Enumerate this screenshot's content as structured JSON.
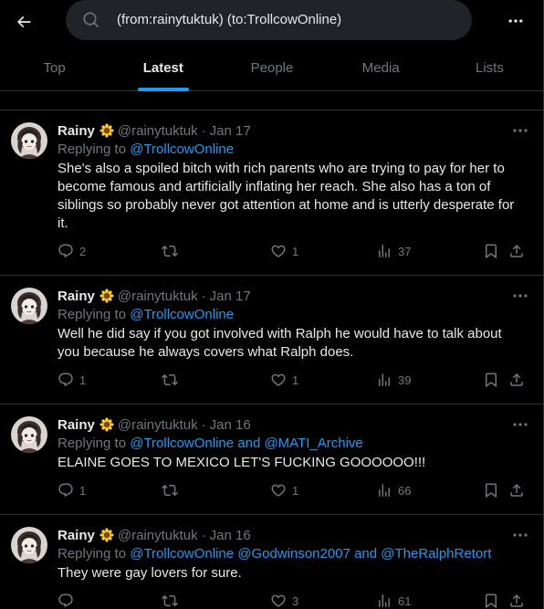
{
  "search": {
    "query": "(from:rainytuktuk) (to:TrollcowOnline)"
  },
  "tabs": [
    {
      "label": "Top"
    },
    {
      "label": "Latest"
    },
    {
      "label": "People"
    },
    {
      "label": "Media"
    },
    {
      "label": "Lists"
    }
  ],
  "active_tab": "Latest",
  "accent_color": "#1d9bf0",
  "posts": [
    {
      "name": "Rainy",
      "emoji": "sunflower",
      "handle": "@rainytuktuk",
      "dot": "·",
      "date": "Jan 17",
      "reply_prefix": "Replying to",
      "reply_to": "@TrollcowOnline",
      "text": "She's also a spoiled bitch with rich parents who are trying to pay for her to become famous and artificially inflating her reach. She also has a ton of siblings so probably never got attention at home and is utterly desperate for it.",
      "replies": "2",
      "retweets": "",
      "likes": "1",
      "views": "37"
    },
    {
      "name": "Rainy",
      "emoji": "sunflower",
      "handle": "@rainytuktuk",
      "dot": "·",
      "date": "Jan 17",
      "reply_prefix": "Replying to",
      "reply_to": "@TrollcowOnline",
      "text": "Well he did say if you got involved with Ralph he would have to talk about you because he always covers what Ralph does.",
      "replies": "1",
      "retweets": "",
      "likes": "1",
      "views": "39"
    },
    {
      "name": "Rainy",
      "emoji": "sunflower",
      "handle": "@rainytuktuk",
      "dot": "·",
      "date": "Jan 16",
      "reply_prefix": "Replying to",
      "reply_to": "@TrollcowOnline and @MATI_Archive",
      "text": "ELAINE GOES TO MEXICO LET'S FUCKING GOOOOOO!!!",
      "replies": "1",
      "retweets": "",
      "likes": "1",
      "views": "66"
    },
    {
      "name": "Rainy",
      "emoji": "sunflower",
      "handle": "@rainytuktuk",
      "dot": "·",
      "date": "Jan 16",
      "reply_prefix": "Replying to",
      "reply_to": "@TrollcowOnline @Godwinson2007 and @TheRalphRetort",
      "text": "They were gay lovers for sure.",
      "replies": "",
      "retweets": "",
      "likes": "3",
      "views": "61"
    }
  ]
}
